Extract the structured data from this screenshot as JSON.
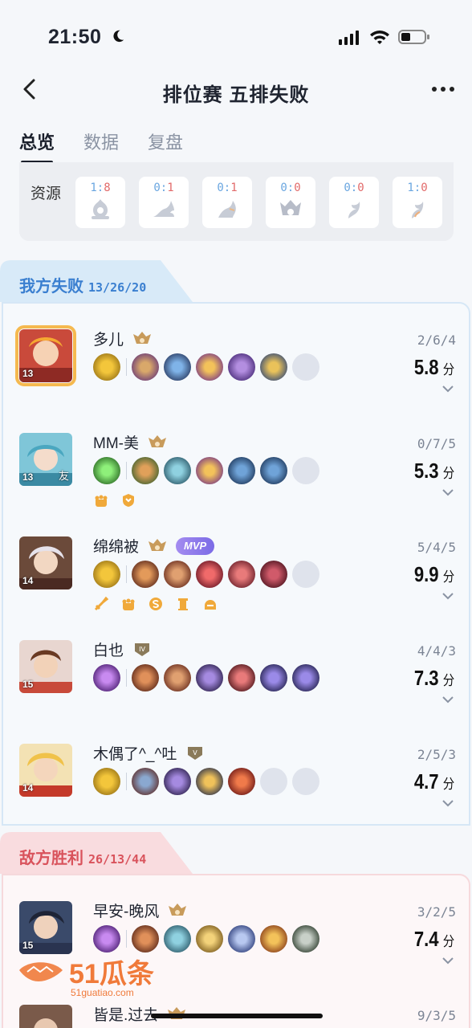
{
  "status_bar": {
    "time": "21:50"
  },
  "header": {
    "title": "排位赛 五排失败"
  },
  "tabs": [
    {
      "label": "总览",
      "active": true
    },
    {
      "label": "数据",
      "active": false
    },
    {
      "label": "复盘",
      "active": false
    }
  ],
  "resources": {
    "label": "资源",
    "items": [
      {
        "left": "1",
        "right": "8",
        "icon": "tyrant-icon"
      },
      {
        "left": "0",
        "right": "1",
        "icon": "dragon-icon"
      },
      {
        "left": "0",
        "right": "1",
        "icon": "dragon-icon"
      },
      {
        "left": "0",
        "right": "0",
        "icon": "lord-icon"
      },
      {
        "left": "0",
        "right": "0",
        "icon": "storm-dragon-icon"
      },
      {
        "left": "1",
        "right": "0",
        "icon": "flame-icon"
      }
    ]
  },
  "our_team": {
    "label": "我方失败",
    "kda": "13/26/20",
    "players": [
      {
        "name": "多儿",
        "level": "13",
        "kda": "2/6/4",
        "score": "5.8",
        "unit": "分",
        "friend": "",
        "mvp": false
      },
      {
        "name": "MM-美",
        "level": "13",
        "kda": "0/7/5",
        "score": "5.3",
        "unit": "分",
        "friend": "友",
        "mvp": false
      },
      {
        "name": "绵绵被",
        "level": "14",
        "kda": "5/4/5",
        "score": "9.9",
        "unit": "分",
        "friend": "",
        "mvp": true,
        "mvp_label": "MVP"
      },
      {
        "name": "白也",
        "level": "15",
        "kda": "4/4/3",
        "score": "7.3",
        "unit": "分",
        "friend": "",
        "mvp": false,
        "rank": "IV"
      },
      {
        "name": "木偶了^_^吐",
        "level": "14",
        "kda": "2/5/3",
        "score": "4.7",
        "unit": "分",
        "friend": "",
        "mvp": false,
        "rank": "V"
      }
    ]
  },
  "enemy_team": {
    "label": "敌方胜利",
    "kda": "26/13/44",
    "players": [
      {
        "name": "早安-晚风",
        "level": "15",
        "kda": "3/2/5",
        "score": "7.4",
        "unit": "分"
      },
      {
        "name": "皆是.过去",
        "level": "",
        "kda": "9/3/5",
        "score": "",
        "unit": ""
      }
    ]
  },
  "watermark": {
    "brand": "51瓜条",
    "url": "51guatiao.com"
  },
  "colors": {
    "blue_team": "#3a7fd0",
    "red_team": "#d9535c",
    "mvp": "#8a76ec",
    "accent_gold": "#f0a93a"
  }
}
